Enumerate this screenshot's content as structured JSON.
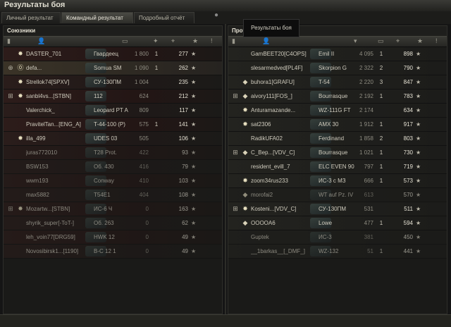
{
  "window": {
    "title": "Результаты боя"
  },
  "tabs": [
    "Личный результат",
    "Командный результат",
    "Подробный отчёт"
  ],
  "tooltip": "Результаты боя",
  "left": {
    "title": "Союзники",
    "rows": [
      {
        "name": "DASTER_701",
        "vehicle": "Гвардеец",
        "damage": "1 800",
        "frags": "1",
        "xp": "277",
        "icon": "star",
        "style": "alt"
      },
      {
        "name": "defa...",
        "vehicle": "Somua SM",
        "damage": "1 090",
        "frags": "1",
        "xp": "262",
        "icon": "b",
        "platoon": "⊕",
        "style": "me"
      },
      {
        "name": "Strellok74[SPXV]",
        "vehicle": "СУ-130ПМ",
        "damage": "1 004",
        "frags": "",
        "xp": "235",
        "icon": "star",
        "style": ""
      },
      {
        "name": "sanbl4vs...[STBN]",
        "vehicle": "112",
        "damage": "624",
        "frags": "",
        "xp": "212",
        "icon": "star",
        "platoon": "⊞",
        "style": "alt"
      },
      {
        "name": "Valerchick_",
        "vehicle": "Leopard PT A",
        "damage": "809",
        "frags": "",
        "xp": "117",
        "icon": "",
        "style": ""
      },
      {
        "name": "PravitelTan...[ENG_A]",
        "vehicle": "T-44-100 (P)",
        "damage": "575",
        "frags": "1",
        "xp": "141",
        "icon": "",
        "style": "alt"
      },
      {
        "name": "illa_499",
        "vehicle": "UDES 03",
        "damage": "505",
        "frags": "",
        "xp": "106",
        "icon": "star",
        "style": ""
      },
      {
        "name": "juras772010",
        "vehicle": "T28 Prot.",
        "damage": "422",
        "frags": "",
        "xp": "93",
        "icon": "",
        "style": "alt dead"
      },
      {
        "name": "BSW153",
        "vehicle": "Об. 430",
        "damage": "416",
        "frags": "",
        "xp": "79",
        "icon": "",
        "style": "dead"
      },
      {
        "name": "wwm193",
        "vehicle": "Conway",
        "damage": "410",
        "frags": "",
        "xp": "103",
        "icon": "",
        "style": "alt dead"
      },
      {
        "name": "max5882",
        "vehicle": "T54E1",
        "damage": "404",
        "frags": "",
        "xp": "108",
        "icon": "",
        "style": "dead"
      },
      {
        "name": "Mozartw...[STBN]",
        "vehicle": "ИС-6 Ч",
        "damage": "0",
        "frags": "",
        "xp": "163",
        "icon": "star",
        "platoon": "⊞",
        "style": "alt dead"
      },
      {
        "name": "shyrik_super[-ToT-]",
        "vehicle": "Об. 263",
        "damage": "0",
        "frags": "",
        "xp": "62",
        "icon": "",
        "style": "dead"
      },
      {
        "name": "leh_voin77[DRG59]",
        "vehicle": "HWK 12",
        "damage": "0",
        "frags": "",
        "xp": "49",
        "icon": "",
        "style": "alt dead"
      },
      {
        "name": "Novosibirsk1...[1190]",
        "vehicle": "В-С 12 1",
        "damage": "0",
        "frags": "",
        "xp": "49",
        "icon": "",
        "style": "dead"
      }
    ]
  },
  "right": {
    "title": "Прот",
    "rows": [
      {
        "name": "GamBEET20[C4OPS]",
        "vehicle": "Emil II",
        "damage": "4 095",
        "frags": "1",
        "xp": "898",
        "icon": "",
        "style": ""
      },
      {
        "name": "slesarmedved[PL4F]",
        "vehicle": "Skorpion G",
        "damage": "2 322",
        "frags": "2",
        "xp": "790",
        "icon": "",
        "style": ""
      },
      {
        "name": "buhora1[GRAFU]",
        "vehicle": "T-54",
        "damage": "2 220",
        "frags": "3",
        "xp": "847",
        "icon": "diamond",
        "style": ""
      },
      {
        "name": "aivory111[FOS_]",
        "vehicle": "Bourrasque",
        "damage": "2 192",
        "frags": "1",
        "xp": "783",
        "icon": "diamond",
        "platoon": "⊞",
        "style": ""
      },
      {
        "name": "Anturamazande...",
        "vehicle": "WZ-111G FT",
        "damage": "2 174",
        "frags": "",
        "xp": "634",
        "icon": "star",
        "style": ""
      },
      {
        "name": "sat2306",
        "vehicle": "AMX 30",
        "damage": "1 912",
        "frags": "1",
        "xp": "917",
        "icon": "star",
        "style": ""
      },
      {
        "name": "RadikUFA02",
        "vehicle": "Ferdinand",
        "damage": "1 858",
        "frags": "2",
        "xp": "803",
        "icon": "",
        "style": ""
      },
      {
        "name": "C_Bep...[VDV_C]",
        "vehicle": "Bourrasque",
        "damage": "1 021",
        "frags": "1",
        "xp": "730",
        "icon": "diamond",
        "platoon": "⊞",
        "style": ""
      },
      {
        "name": "resident_evill_7",
        "vehicle": "ELC EVEN 90",
        "damage": "797",
        "frags": "1",
        "xp": "719",
        "icon": "",
        "style": ""
      },
      {
        "name": "zoom34rus233",
        "vehicle": "ИС-3 с МЗ",
        "damage": "666",
        "frags": "1",
        "xp": "573",
        "icon": "star",
        "style": ""
      },
      {
        "name": "morofai2",
        "vehicle": "WT auf Pz. IV",
        "damage": "613",
        "frags": "",
        "xp": "570",
        "icon": "diamond",
        "style": "dead"
      },
      {
        "name": "Kosteni...[VDV_C]",
        "vehicle": "СУ-130ПМ",
        "damage": "531",
        "frags": "",
        "xp": "511",
        "icon": "star",
        "platoon": "⊞",
        "style": ""
      },
      {
        "name": "OOOOA6",
        "vehicle": "Lowe",
        "damage": "477",
        "frags": "1",
        "xp": "594",
        "icon": "diamond",
        "style": ""
      },
      {
        "name": "Guptek",
        "vehicle": "ИС-3",
        "damage": "381",
        "frags": "",
        "xp": "450",
        "icon": "",
        "style": "dead"
      },
      {
        "name": "__1barkas__[_DMF_]",
        "vehicle": "WZ-132",
        "damage": "51",
        "frags": "1",
        "xp": "441",
        "icon": "",
        "style": "dead"
      }
    ]
  },
  "icons": {
    "star": "✸",
    "diamond": "◆",
    "b": "⓪",
    "xp": "★"
  }
}
